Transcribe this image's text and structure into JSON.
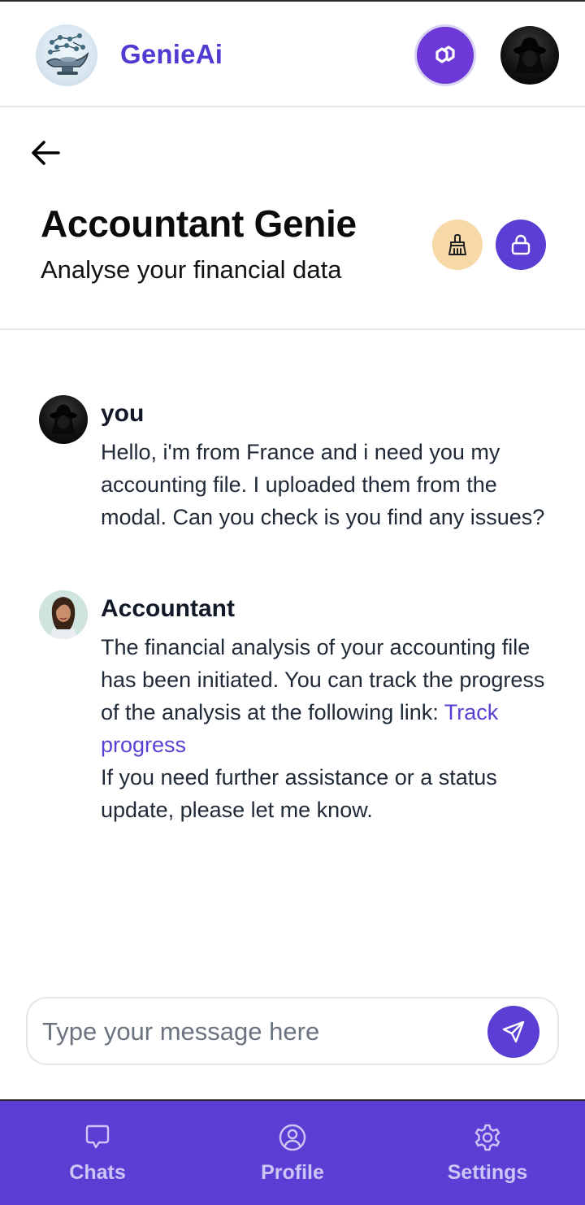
{
  "app": {
    "brand": "GenieAi"
  },
  "page": {
    "title": "Accountant Genie",
    "subtitle": "Analyse your financial data"
  },
  "messages": [
    {
      "sender": "you",
      "text": "Hello, i'm from France and i need you my accounting file. I uploaded them from the modal. Can you check is you find any issues?"
    },
    {
      "sender": "Accountant",
      "text_before_link": "The financial analysis of your accounting file has been initiated. You can track the progress of the analysis at the following link: ",
      "link_label": "Track progress",
      "text_after_link": "If you need further assistance or a status update, please let me know."
    }
  ],
  "composer": {
    "placeholder": "Type your message here"
  },
  "nav": [
    {
      "label": "Chats",
      "icon": "chat-bubble-icon"
    },
    {
      "label": "Profile",
      "icon": "user-circle-icon"
    },
    {
      "label": "Settings",
      "icon": "gear-icon"
    }
  ],
  "colors": {
    "accent": "#5b3fd4",
    "clean_button": "#f7d9a8",
    "chain_button": "#6d38d8"
  }
}
